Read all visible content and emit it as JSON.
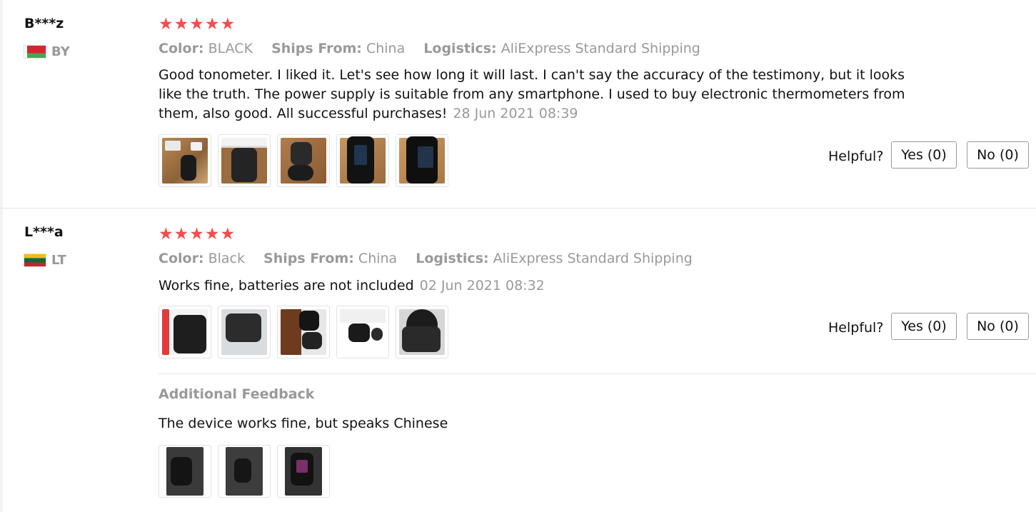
{
  "reviews": [
    {
      "user": "B***z",
      "country": "BY",
      "stars": "★★★★★",
      "meta": {
        "color_label": "Color:",
        "color_value": "BLACK",
        "ships_label": "Ships From:",
        "ships_value": "China",
        "logistics_label": "Logistics:",
        "logistics_value": "AliExpress Standard Shipping"
      },
      "text": "Good tonometer. I liked it. Let's see how long it will last. I can't say the accuracy of the testimony, but it looks like the truth. The power supply is suitable from any smartphone. I used to buy electronic thermometers from them, also good. All successful purchases!",
      "date": "28 Jun 2021 08:39",
      "helpful_label": "Helpful?",
      "yes_label": "Yes (0)",
      "no_label": "No (0)"
    },
    {
      "user": "L***a",
      "country": "LT",
      "stars": "★★★★★",
      "meta": {
        "color_label": "Color:",
        "color_value": "Black",
        "ships_label": "Ships From:",
        "ships_value": "China",
        "logistics_label": "Logistics:",
        "logistics_value": "AliExpress Standard Shipping"
      },
      "text": "Works fine, batteries are not included",
      "date": "02 Jun 2021 08:32",
      "helpful_label": "Helpful?",
      "yes_label": "Yes (0)",
      "no_label": "No (0)",
      "additional_feedback": {
        "title": "Additional Feedback",
        "text": "The device works fine, but speaks Chinese"
      }
    }
  ],
  "colors": {
    "star": "#f24e4e",
    "muted": "#999999",
    "border": "#e6e6e6"
  }
}
